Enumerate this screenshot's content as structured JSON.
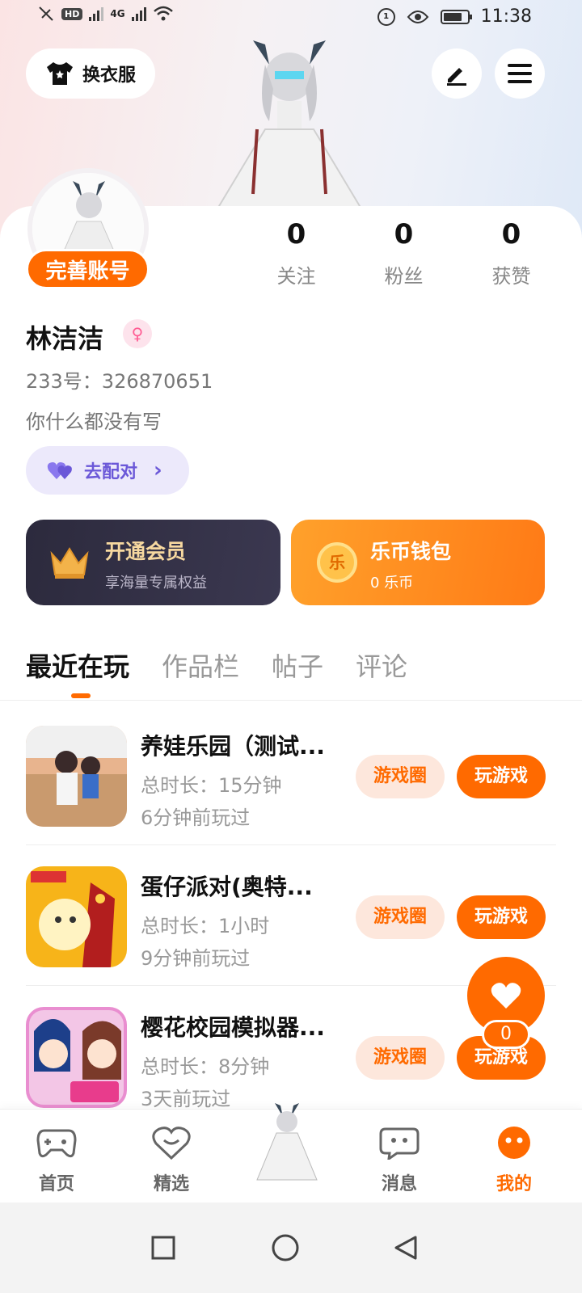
{
  "status_bar": {
    "time": "11:38",
    "hd_label": "HD",
    "network_label": "4G"
  },
  "top": {
    "dress_label": "换衣服"
  },
  "profile": {
    "complete_badge": "完善账号",
    "stats": [
      {
        "value": "0",
        "label": "关注"
      },
      {
        "value": "0",
        "label": "粉丝"
      },
      {
        "value": "0",
        "label": "获赞"
      }
    ],
    "username": "林洁洁",
    "gender_symbol": "♀",
    "uid": "233号：326870651",
    "bio": "你什么都没有写",
    "match_label": "去配对",
    "match_arrow": "›"
  },
  "cards": {
    "vip": {
      "title": "开通会员",
      "subtitle": "享海量专属权益"
    },
    "wallet": {
      "title": "乐币钱包",
      "subtitle": "0 乐币",
      "coin_glyph": "乐"
    }
  },
  "tabs": [
    "最近在玩",
    "作品栏",
    "帖子",
    "评论"
  ],
  "games": [
    {
      "name": "养娃乐园（测试...",
      "duration": "总时长：15分钟",
      "last_played": "6分钟前玩过",
      "circle_label": "游戏圈",
      "play_label": "玩游戏"
    },
    {
      "name": "蛋仔派对(奥特...",
      "duration": "总时长：1小时",
      "last_played": "9分钟前玩过",
      "circle_label": "游戏圈",
      "play_label": "玩游戏"
    },
    {
      "name": "樱花校园模拟器...",
      "duration": "总时长：8分钟",
      "last_played": "3天前玩过",
      "circle_label": "游戏圈",
      "play_label": "玩游戏"
    }
  ],
  "float_like": {
    "count": "0"
  },
  "bottom_nav": [
    {
      "label": "首页",
      "icon": "gamepad-icon"
    },
    {
      "label": "精选",
      "icon": "heart-bubble-icon"
    },
    {
      "label": "消息",
      "icon": "chat-icon"
    },
    {
      "label": "我的",
      "icon": "profile-face-icon"
    }
  ],
  "colors": {
    "accent": "#ff6a00",
    "match": "#6b58d8"
  }
}
